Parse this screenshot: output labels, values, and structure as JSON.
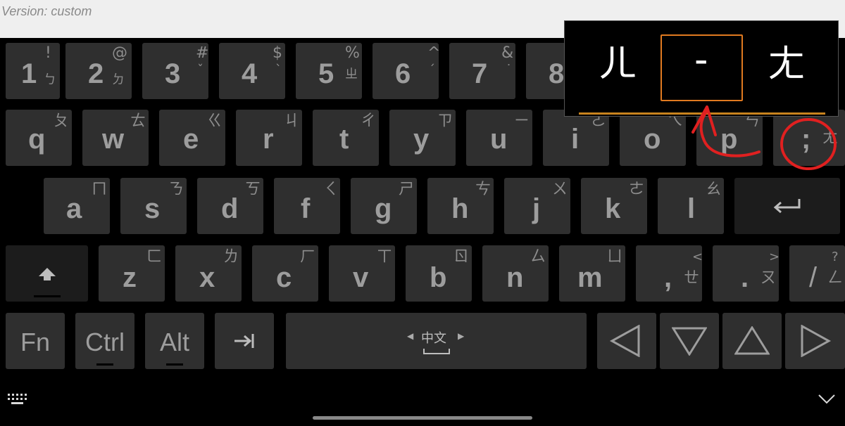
{
  "header": {
    "version_text": "Version: custom"
  },
  "number_row": [
    {
      "main": "1",
      "sub": "!",
      "sub2": "ㄅ"
    },
    {
      "main": "2",
      "sub": "@",
      "sub2": "ㄉ"
    },
    {
      "main": "3",
      "sub": "#",
      "sub2": "ˇ"
    },
    {
      "main": "4",
      "sub": "$",
      "sub2": "ˋ"
    },
    {
      "main": "5",
      "sub": "%",
      "sub2": "ㄓ"
    },
    {
      "main": "6",
      "sub": "^",
      "sub2": "ˊ"
    },
    {
      "main": "7",
      "sub": "&",
      "sub2": "˙"
    },
    {
      "main": "8",
      "sub": "",
      "sub2": ""
    }
  ],
  "row_q": [
    {
      "main": "q",
      "sub": "ㄆ"
    },
    {
      "main": "w",
      "sub": "ㄊ"
    },
    {
      "main": "e",
      "sub": "ㄍ"
    },
    {
      "main": "r",
      "sub": "ㄐ"
    },
    {
      "main": "t",
      "sub": "ㄔ"
    },
    {
      "main": "y",
      "sub": "ㄗ"
    },
    {
      "main": "u",
      "sub": "ㄧ"
    },
    {
      "main": "i",
      "sub": "ㄛ"
    },
    {
      "main": "o",
      "sub": "ㄟ"
    },
    {
      "main": "p",
      "sub": "ㄣ"
    },
    {
      "main": ";",
      "sub": "ㄤ"
    }
  ],
  "row_a": [
    {
      "main": "a",
      "sub": "ㄇ"
    },
    {
      "main": "s",
      "sub": "ㄋ"
    },
    {
      "main": "d",
      "sub": "ㄎ"
    },
    {
      "main": "f",
      "sub": "ㄑ"
    },
    {
      "main": "g",
      "sub": "ㄕ"
    },
    {
      "main": "h",
      "sub": "ㄘ"
    },
    {
      "main": "j",
      "sub": "ㄨ"
    },
    {
      "main": "k",
      "sub": "ㄜ"
    },
    {
      "main": "l",
      "sub": "ㄠ"
    }
  ],
  "row_z": [
    {
      "main": "z",
      "sub": "ㄈ"
    },
    {
      "main": "x",
      "sub": "ㄌ"
    },
    {
      "main": "c",
      "sub": "ㄏ"
    },
    {
      "main": "v",
      "sub": "ㄒ"
    },
    {
      "main": "b",
      "sub": "ㄖ"
    },
    {
      "main": "n",
      "sub": "ㄙ"
    },
    {
      "main": "m",
      "sub": "ㄩ"
    },
    {
      "main": ",",
      "sub": "<",
      "sub2": "ㄝ"
    },
    {
      "main": ".",
      "sub": ">",
      "sub2": "ㄡ"
    },
    {
      "main": "/",
      "sub": "?",
      "sub2": "ㄥ"
    }
  ],
  "bottom_row": {
    "fn": "Fn",
    "ctrl": "Ctrl",
    "alt": "Alt",
    "space_label": "中文"
  },
  "candidate_popup": {
    "candidates": [
      "ㄦ",
      "-",
      "ㄤ"
    ],
    "selected_index": 1
  },
  "colors": {
    "key_bg": "#2f2f2f",
    "key_text": "#9d9d9d",
    "popup_highlight": "#e07a20",
    "annotation": "#e02020"
  }
}
